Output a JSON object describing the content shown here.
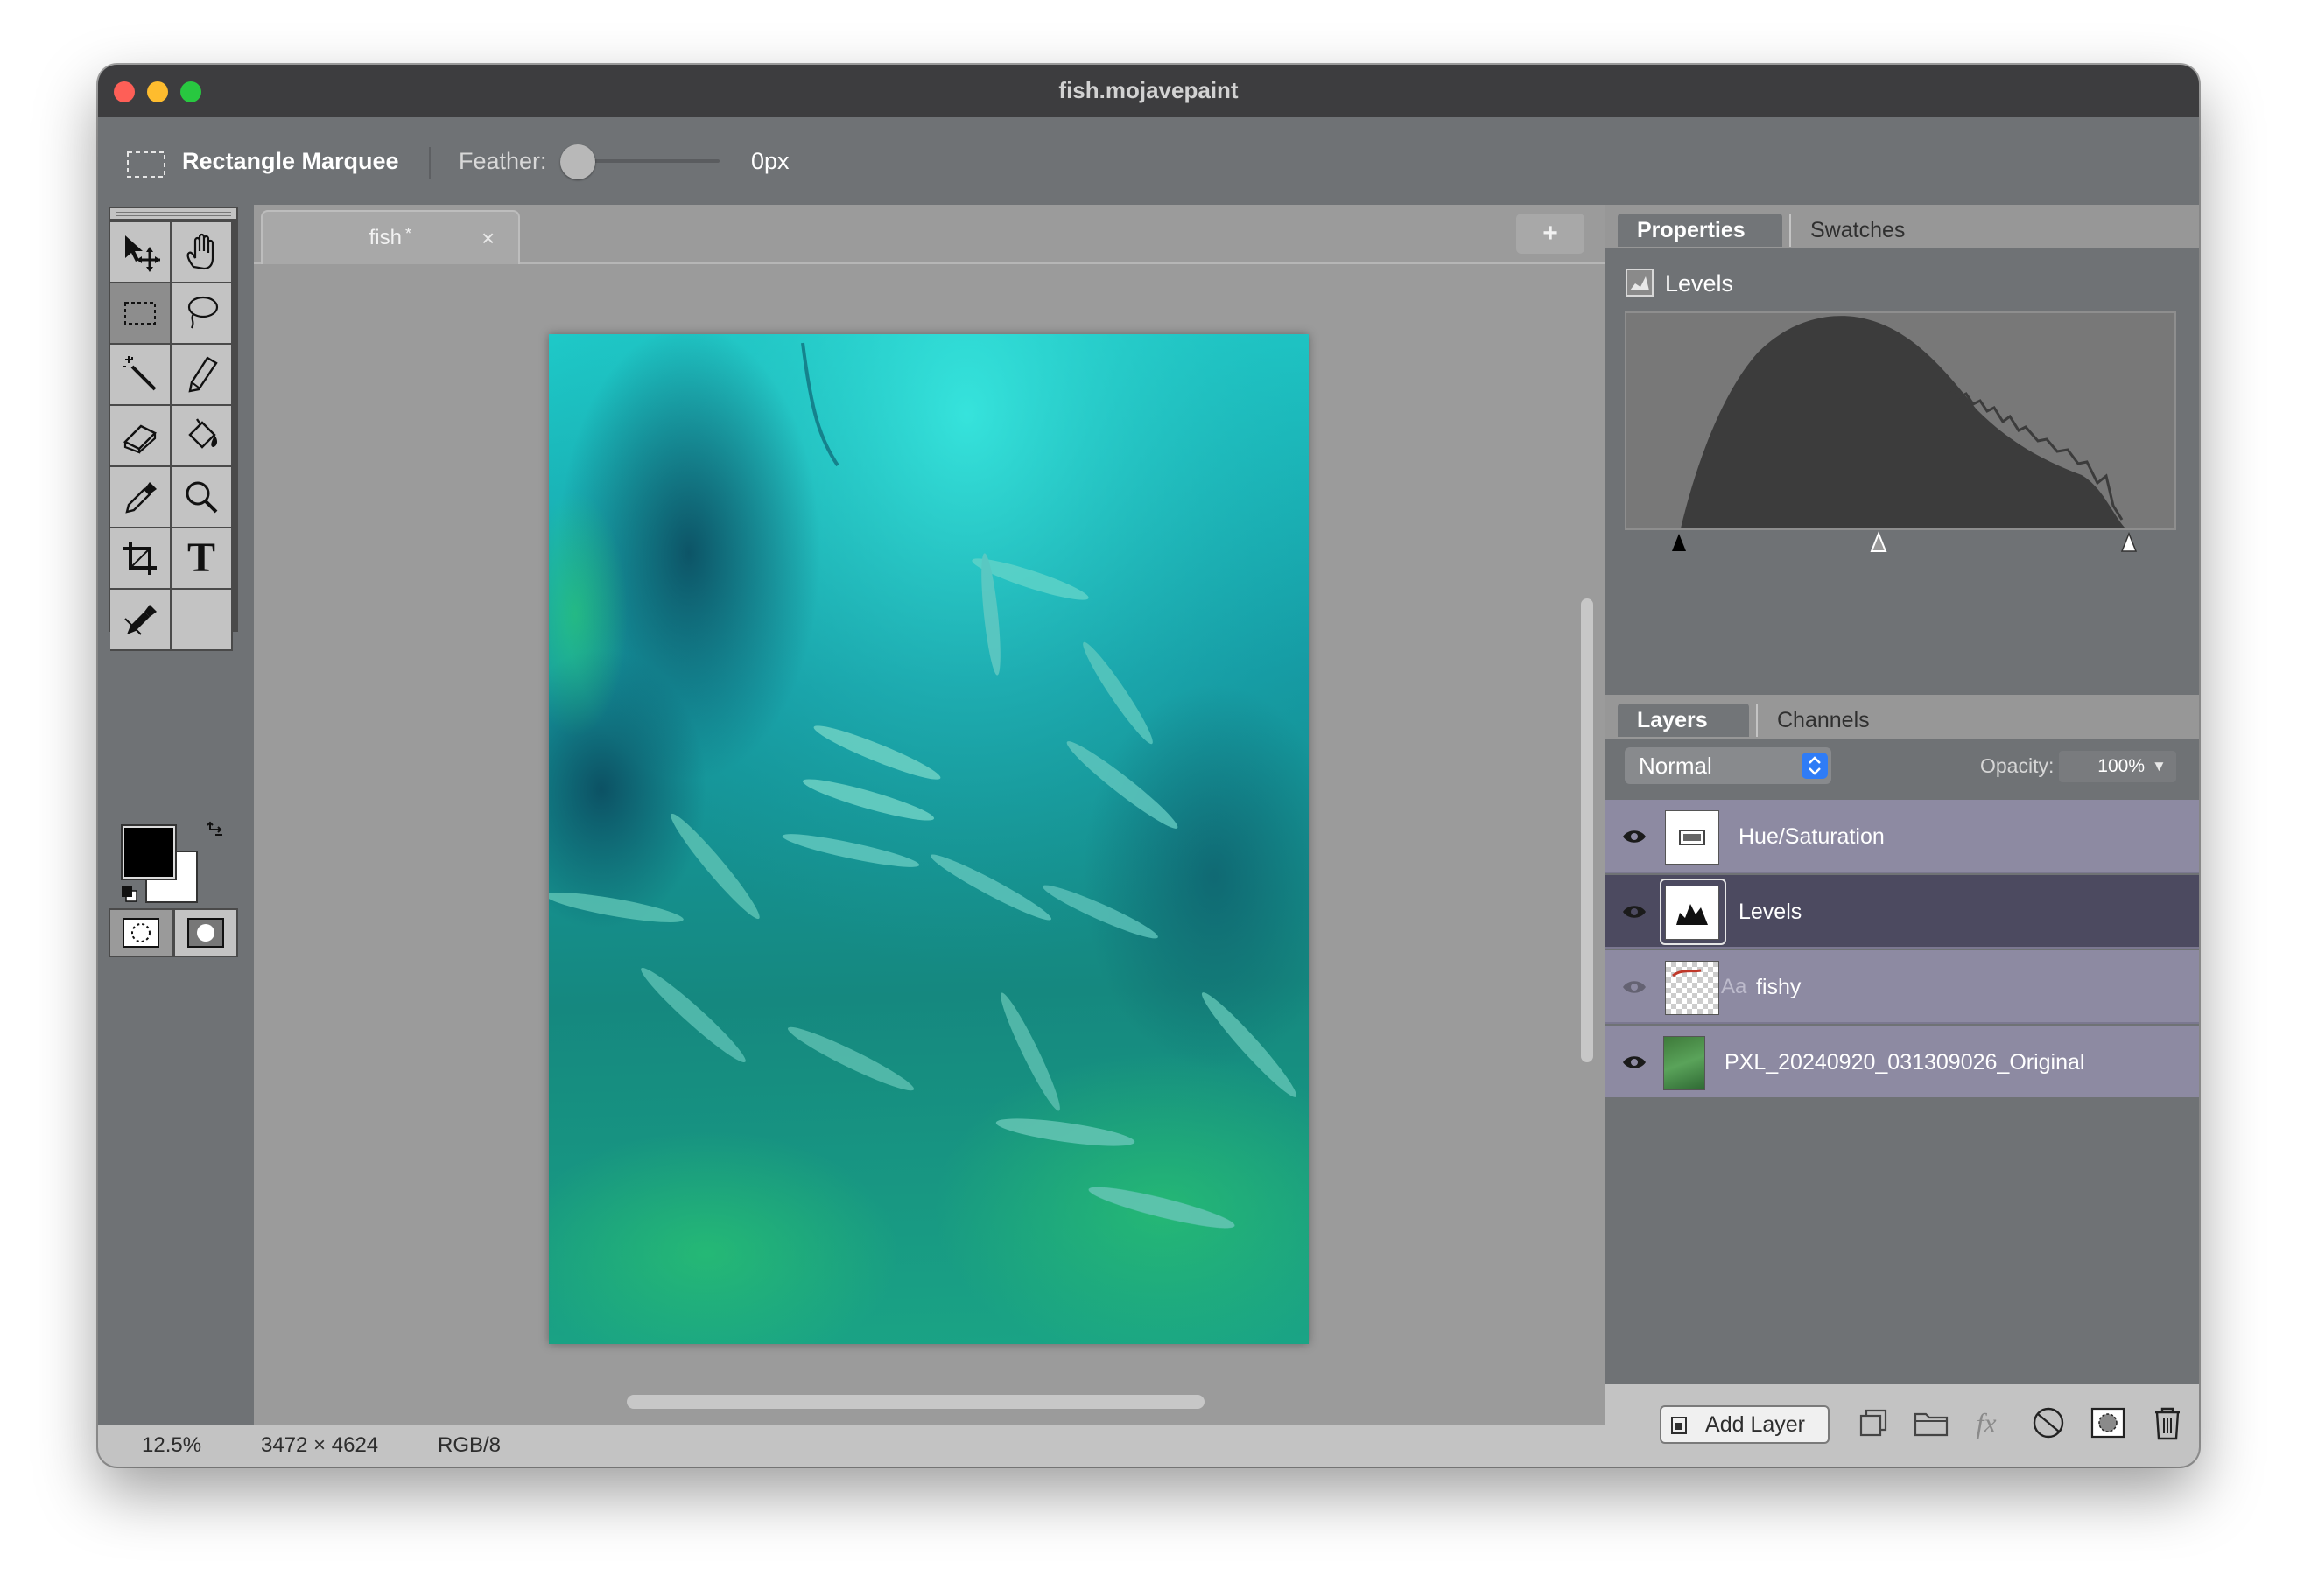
{
  "window": {
    "title": "fish.mojavepaint"
  },
  "options_bar": {
    "tool_name": "Rectangle Marquee",
    "feather_label": "Feather:",
    "feather_value": "0px",
    "feather_level": 0
  },
  "toolbox": {
    "tools": [
      "move-tool",
      "hand-tool",
      "rectangle-marquee-tool",
      "lasso-tool",
      "magic-wand-tool",
      "pencil-tool",
      "eraser-tool",
      "paint-bucket-tool",
      "eyedropper-tool",
      "zoom-tool",
      "crop-tool",
      "text-tool",
      "color-sampler-tool"
    ],
    "active_tool": "rectangle-marquee-tool",
    "text_tool_glyph": "T",
    "foreground_color": "#000000",
    "background_color": "#ffffff"
  },
  "document": {
    "tab_label": "fish",
    "modified_marker": "*",
    "close_glyph": "×",
    "new_tab_glyph": "+"
  },
  "status": {
    "zoom": "12.5%",
    "dimensions": "3472 × 4624",
    "mode": "RGB/8"
  },
  "properties_panel": {
    "tabs": [
      "Properties",
      "Swatches"
    ],
    "active_tab": "Properties",
    "adjustment_title": "Levels",
    "levels": {
      "input_black": 0,
      "input_gamma": 1.0,
      "input_white": 255
    }
  },
  "layers_panel": {
    "tabs": [
      "Layers",
      "Channels"
    ],
    "active_tab": "Layers",
    "blend_mode": "Normal",
    "opacity_label": "Opacity:",
    "opacity_value": "100%",
    "opacity_arrow": "▼",
    "layers": [
      {
        "name": "Hue/Saturation",
        "kind": "adjustment",
        "visible": true,
        "selected": false
      },
      {
        "name": "Levels",
        "kind": "adjustment",
        "visible": true,
        "selected": true
      },
      {
        "name": "fishy",
        "kind": "text",
        "type_prefix": "Aa",
        "visible": false,
        "selected": false
      },
      {
        "name": "PXL_20240920_031309026_Original",
        "kind": "image",
        "visible": true,
        "selected": false
      }
    ],
    "add_layer_label": "Add Layer",
    "fx_label": "fx"
  },
  "colors": {
    "accent": "#2f7cf6",
    "selected_layer": "#4c4a60",
    "layer_row": "#8d8aa2",
    "close": "#fe5f57",
    "minimize": "#febc2e",
    "zoom": "#28c840"
  }
}
